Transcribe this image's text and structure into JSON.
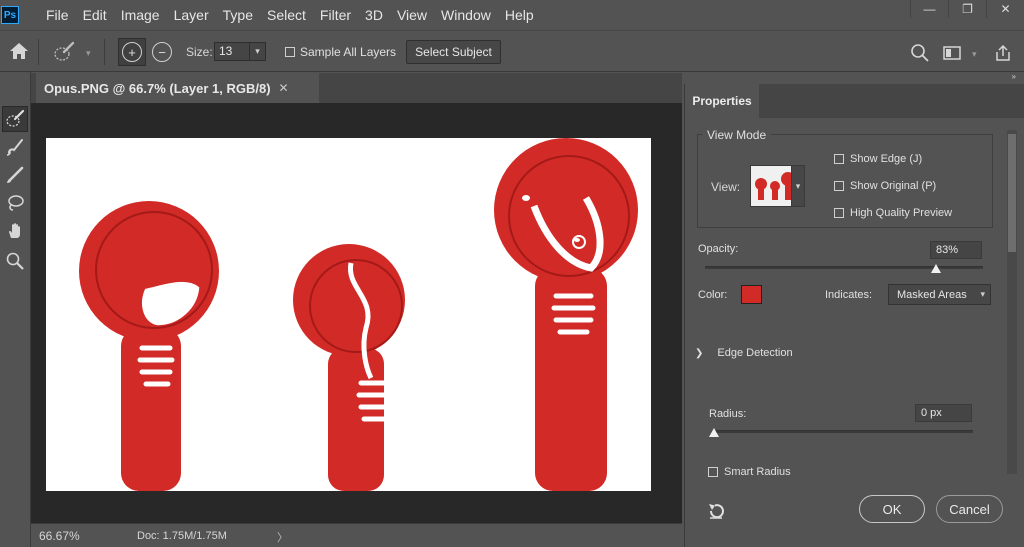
{
  "app": {
    "logo": "Ps"
  },
  "menu": [
    "File",
    "Edit",
    "Image",
    "Layer",
    "Type",
    "Select",
    "Filter",
    "3D",
    "View",
    "Window",
    "Help"
  ],
  "window_controls": {
    "minimize": "—",
    "restore": "❐",
    "close": "✕"
  },
  "options": {
    "size_label": "Size:",
    "size_value": "13",
    "sample_all_layers": "Sample All Layers",
    "select_subject": "Select Subject"
  },
  "document": {
    "tab_title": "Opus.PNG @ 66.7% (Layer 1, RGB/8)",
    "zoom": "66.67%",
    "doc_size": "Doc: 1.75M/1.75M"
  },
  "properties": {
    "tab": "Properties",
    "view_mode": "View Mode",
    "view_label": "View:",
    "show_edge": "Show Edge (J)",
    "show_original": "Show Original (P)",
    "high_quality_preview": "High Quality Preview",
    "opacity_label": "Opacity:",
    "opacity_value": "83%",
    "opacity_fraction": 0.83,
    "color_label": "Color:",
    "color_value": "#d22a26",
    "indicates_label": "Indicates:",
    "indicates_value": "Masked Areas",
    "edge_detection": "Edge Detection",
    "radius_label": "Radius:",
    "radius_value": "0 px",
    "smart_radius": "Smart Radius",
    "ok": "OK",
    "cancel": "Cancel"
  },
  "colors": {
    "accent_red": "#d22a26",
    "ps_blue": "#31a8ff"
  }
}
